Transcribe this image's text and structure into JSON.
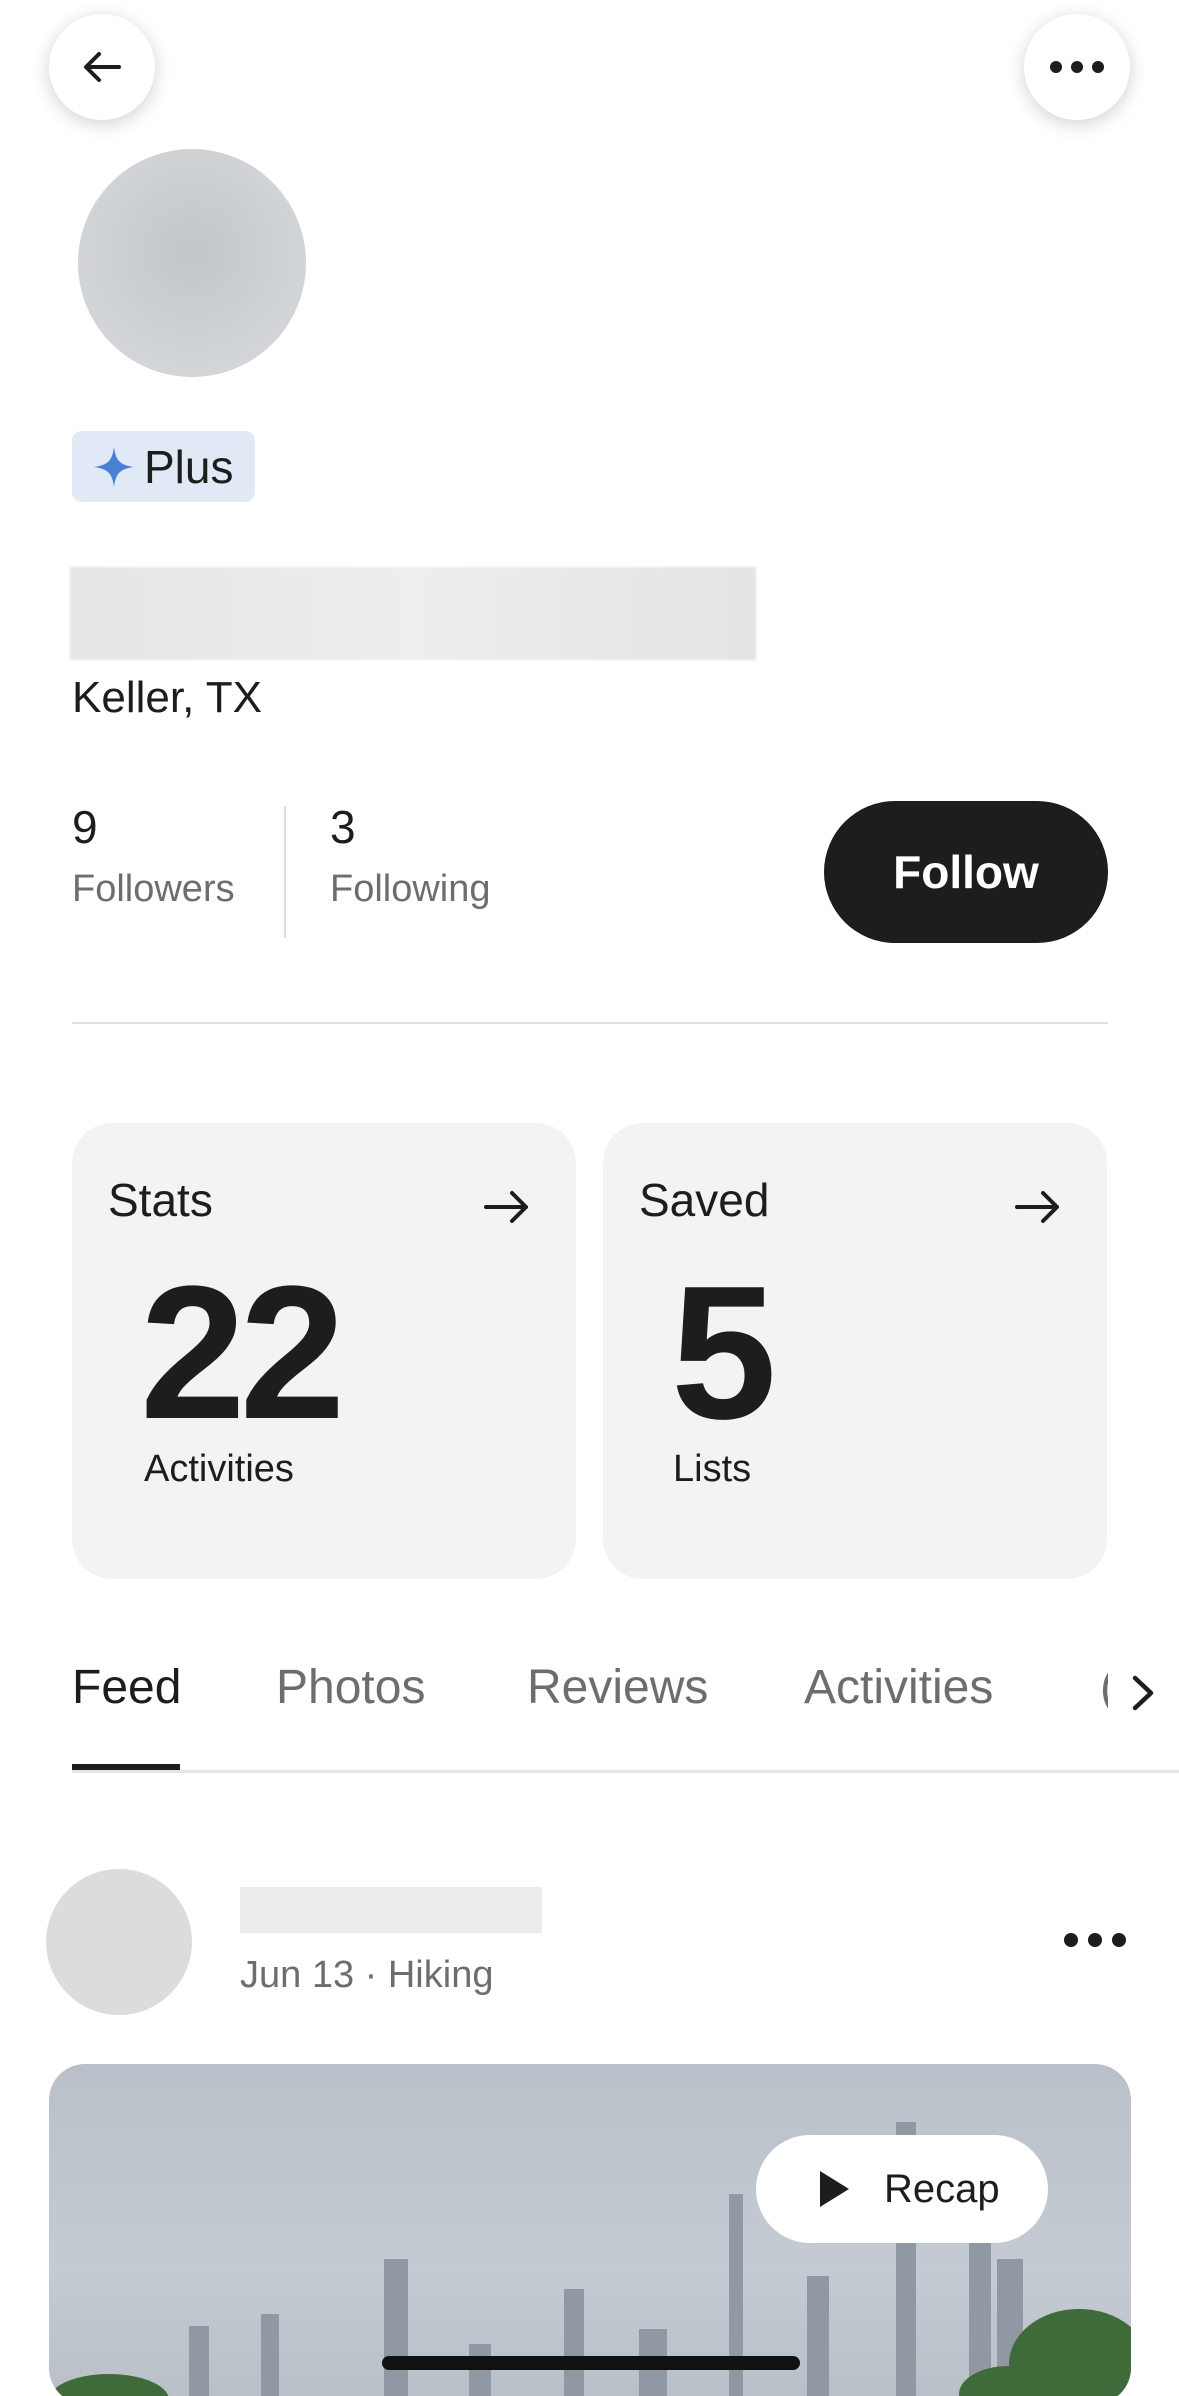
{
  "header": {
    "back_icon": "arrow-left-icon",
    "more_icon": "more-horizontal-icon"
  },
  "profile": {
    "badge_label": "Plus",
    "badge_icon": "sparkle-icon",
    "badge_color": "#4a7fd6",
    "location": "Keller, TX",
    "followers_count": "9",
    "followers_label": "Followers",
    "following_count": "3",
    "following_label": "Following",
    "follow_button": "Follow"
  },
  "cards": {
    "stats": {
      "title": "Stats",
      "value": "22",
      "label": "Activities"
    },
    "saved": {
      "title": "Saved",
      "value": "5",
      "label": "Lists"
    }
  },
  "tabs": [
    {
      "label": "Feed",
      "active": true
    },
    {
      "label": "Photos"
    },
    {
      "label": "Reviews"
    },
    {
      "label": "Activities"
    }
  ],
  "feed": {
    "post": {
      "meta": "Jun 13 · Hiking",
      "recap_label": "Recap"
    }
  },
  "colors": {
    "primary_dark": "#1b1e1a",
    "muted_text": "#6b6f6a",
    "card_bg": "#f3f3f3"
  }
}
